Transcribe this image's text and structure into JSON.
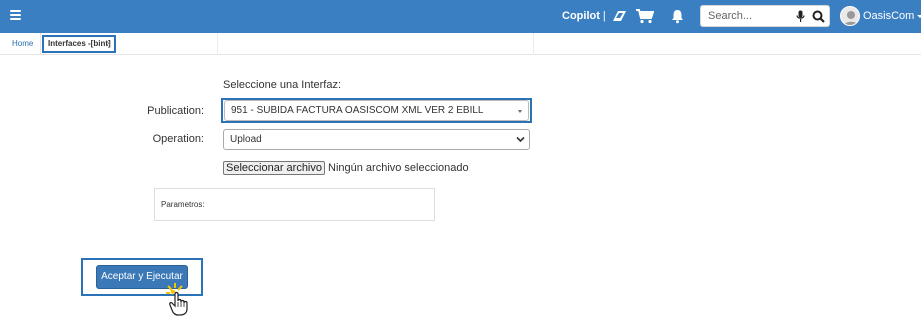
{
  "header": {
    "copilot_label": "Copilot",
    "copilot_sep": "|",
    "search_placeholder": "Search...",
    "user_name": "OasisCom",
    "bar_color": "#3a7fc1"
  },
  "tabs": {
    "home_label": "Home",
    "active_label": "Interfaces -[bint]",
    "close_symbol": "×"
  },
  "form": {
    "title": "Seleccione una Interfaz:",
    "publication_label": "Publication:",
    "publication_value": "951 - SUBIDA FACTURA OASISCOM XML VER 2 EBILL",
    "operation_label": "Operation:",
    "operation_value": "Upload",
    "file_button_label": "Seleccionar archivo",
    "file_status": "Ningún archivo seleccionado",
    "params_label": "Parametros:",
    "submit_label": "Aceptar y Ejecutar"
  },
  "icons": {
    "menu": "menu-icon",
    "copilot": "copilot-icon",
    "cart": "cart-icon",
    "bell": "bell-icon",
    "mic": "mic-icon",
    "search": "search-icon",
    "avatar": "avatar",
    "hand": "hand-cursor-icon"
  },
  "colors": {
    "highlight": "#2a73b8",
    "button": "#3a78b8"
  }
}
